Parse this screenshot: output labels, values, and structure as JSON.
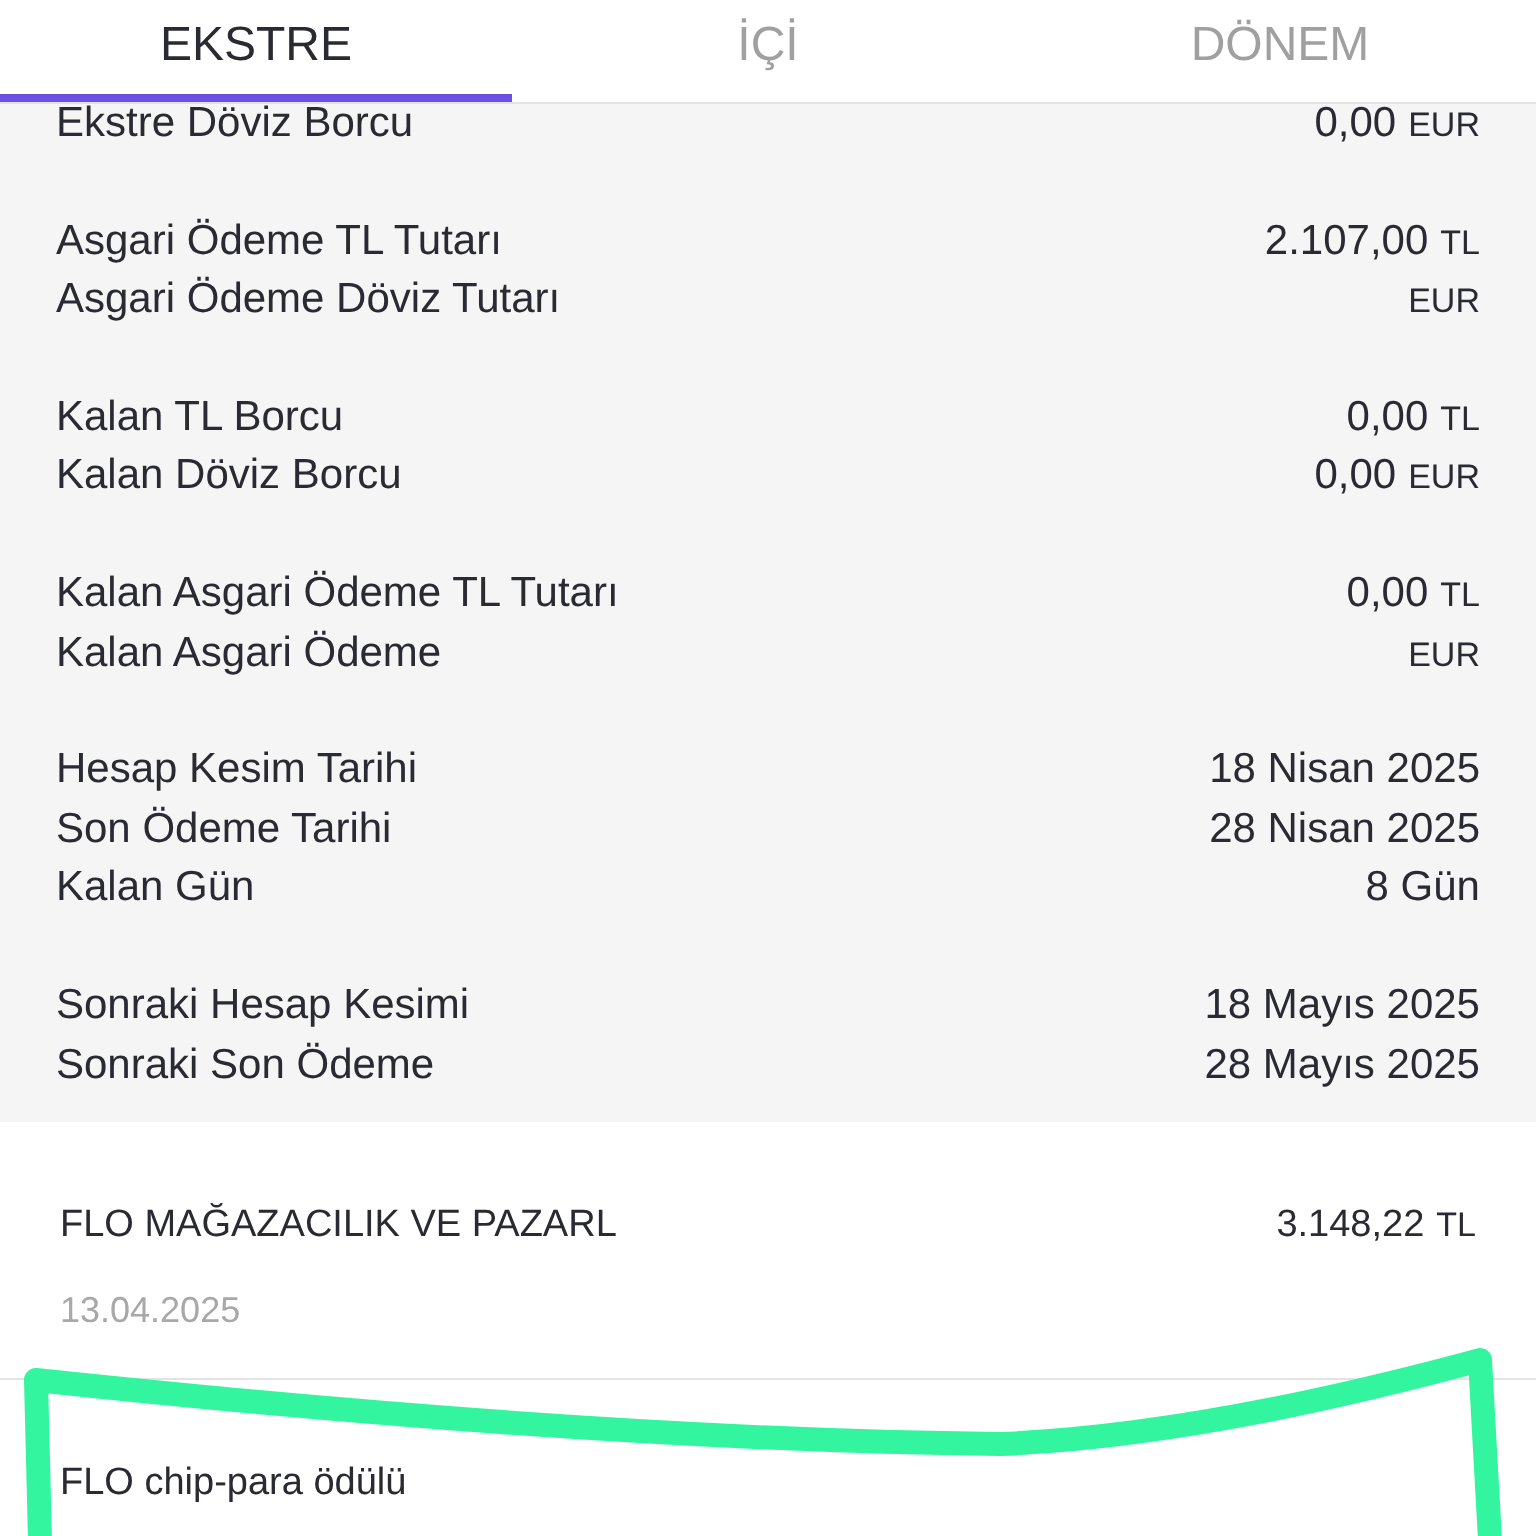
{
  "tabs": [
    {
      "label": "EKSTRE",
      "selected": true
    },
    {
      "label": "İÇİ",
      "selected": false
    },
    {
      "label": "DÖNEM",
      "selected": false
    }
  ],
  "summary_groups": [
    {
      "rows": [
        {
          "label": "Ekstre Döviz Borcu",
          "amount": "0,00",
          "currency": "EUR"
        }
      ]
    },
    {
      "rows": [
        {
          "label": "Asgari Ödeme TL Tutarı",
          "amount": "2.107,00",
          "currency": "TL"
        },
        {
          "label": "Asgari Ödeme Döviz Tutarı",
          "currency": "EUR"
        }
      ]
    },
    {
      "rows": [
        {
          "label": "Kalan TL Borcu",
          "amount": "0,00",
          "currency": "TL"
        },
        {
          "label": "Kalan Döviz Borcu",
          "amount": "0,00",
          "currency": "EUR"
        }
      ]
    },
    {
      "rows": [
        {
          "label": "Kalan Asgari Ödeme TL Tutarı",
          "amount": "0,00",
          "currency": "TL"
        },
        {
          "label": "Kalan Asgari Ödeme",
          "currency": "EUR"
        }
      ]
    },
    {
      "rows": [
        {
          "label": "Hesap Kesim Tarihi",
          "amount": "18 Nisan 2025"
        },
        {
          "label": "Son Ödeme Tarihi",
          "amount": "28 Nisan 2025"
        },
        {
          "label": "Kalan Gün",
          "amount": "8 Gün"
        }
      ]
    },
    {
      "rows": [
        {
          "label": "Sonraki Hesap Kesimi",
          "amount": "18 Mayıs 2025"
        },
        {
          "label": "Sonraki Son Ödeme",
          "amount": "28 Mayıs 2025"
        }
      ]
    }
  ],
  "transactions": [
    {
      "merchant": "FLO MAĞAZACILIK VE PAZARL",
      "amount": "3.148,22",
      "currency": "TL",
      "date": "13.04.2025"
    },
    {
      "merchant": "FLO chip-para ödülü"
    }
  ]
}
